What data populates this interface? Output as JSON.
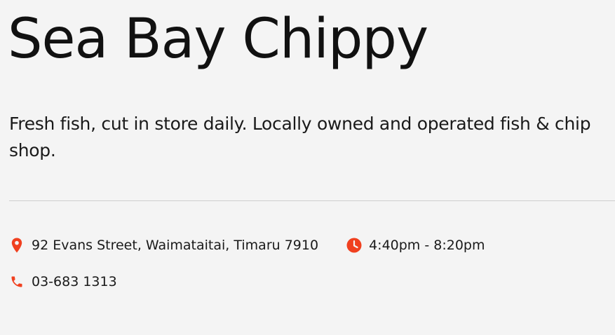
{
  "header": {
    "title": "Sea Bay Chippy"
  },
  "about": {
    "description": "Fresh fish, cut in store daily. Locally owned and operated fish & chip shop."
  },
  "details": {
    "address": "92 Evans Street, Waimataitai, Timaru 7910",
    "hours": "4:40pm - 8:20pm",
    "phone": "03-683 1313"
  },
  "colors": {
    "accent": "#f0401f",
    "background": "#f4f4f4",
    "divider": "#cfcfcf"
  },
  "icons": {
    "address": "map-pin-icon",
    "hours": "clock-icon",
    "phone": "phone-icon"
  }
}
